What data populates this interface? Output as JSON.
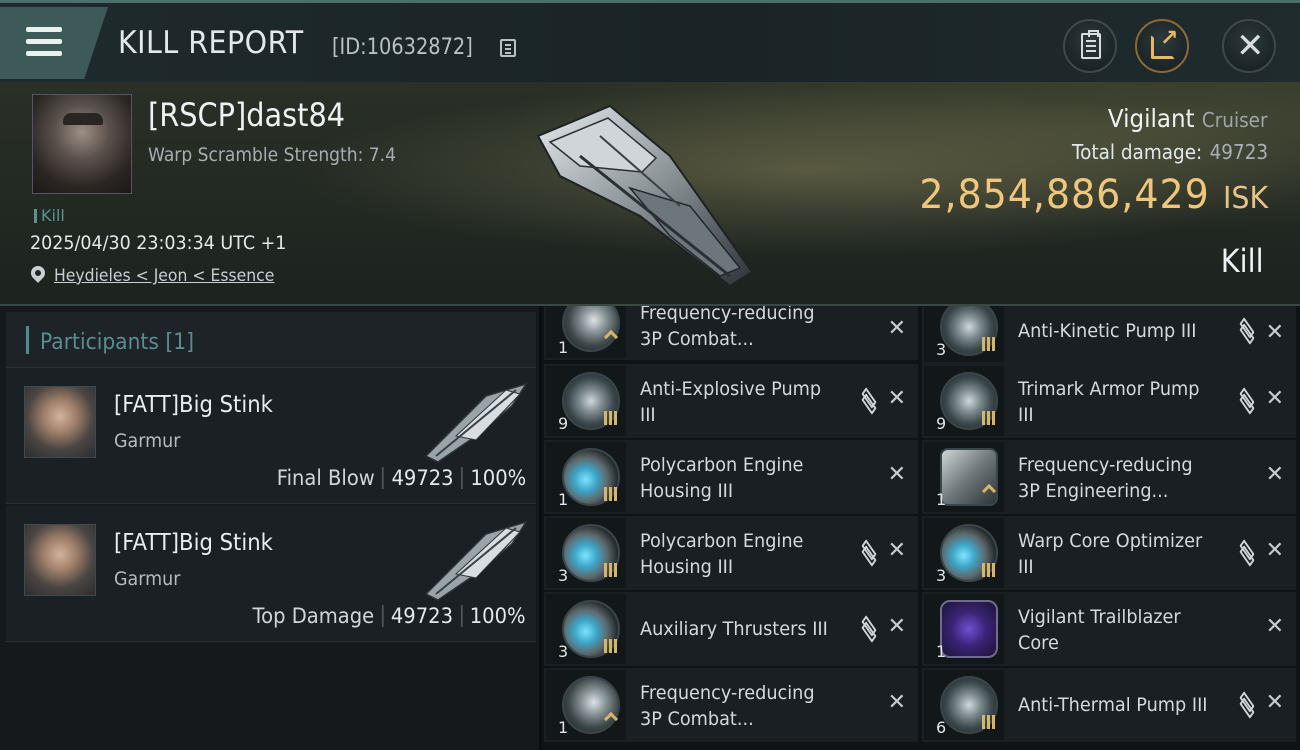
{
  "header": {
    "title": "KILL REPORT",
    "id_text": "[ID:10632872]"
  },
  "victim": {
    "name": "[RSCP]dast84",
    "subtitle": "Warp Scramble Strength: 7.4",
    "kill_tag": "Kill",
    "datetime": "2025/04/30 23:03:34 UTC +1",
    "location": "Heydieles < Jeon < Essence",
    "ship_name": "Vigilant",
    "ship_class": "Cruiser",
    "total_damage_label": "Total damage:",
    "total_damage": "49723",
    "isk_value": "2,854,886,429",
    "isk_unit": "ISK",
    "result": "Kill"
  },
  "participants": {
    "label": "Participants",
    "count": "[1]",
    "rows": [
      {
        "name": "[FATT]Big Stink",
        "ship": "Garmur",
        "role": "Final Blow",
        "damage": "49723",
        "percent": "100%"
      },
      {
        "name": "[FATT]Big Stink",
        "ship": "Garmur",
        "role": "Top Damage",
        "damage": "49723",
        "percent": "100%"
      }
    ]
  },
  "modules": {
    "left": [
      {
        "name": "Frequency-reducing 3P Combat...",
        "qty": "1",
        "icon": "combat-rig-icon"
      },
      {
        "name": "Anti-Explosive Pump III",
        "qty": "9",
        "icon": "armor-pump-icon"
      },
      {
        "name": "Polycarbon Engine Housing III",
        "qty": "1",
        "icon": "engine-rig-icon"
      },
      {
        "name": "Polycarbon Engine Housing III",
        "qty": "3",
        "icon": "engine-rig-icon"
      },
      {
        "name": "Auxiliary Thrusters III",
        "qty": "3",
        "icon": "thruster-rig-icon"
      },
      {
        "name": "Frequency-reducing 3P Combat...",
        "qty": "1",
        "icon": "combat-rig-icon"
      }
    ],
    "right": [
      {
        "name": "Anti-Kinetic Pump III",
        "qty": "3",
        "icon": "armor-pump-icon"
      },
      {
        "name": "Trimark Armor Pump III",
        "qty": "9",
        "icon": "armor-pump-icon"
      },
      {
        "name": "Frequency-reducing 3P Engineering...",
        "qty": "1",
        "icon": "engineering-rig-icon"
      },
      {
        "name": "Warp Core Optimizer III",
        "qty": "3",
        "icon": "warp-rig-icon"
      },
      {
        "name": "Vigilant Trailblazer Core",
        "qty": "1",
        "icon": "core-icon"
      },
      {
        "name": "Anti-Thermal Pump III",
        "qty": "6",
        "icon": "armor-pump-icon"
      }
    ]
  },
  "colors": {
    "accent_teal": "#4f8a8d",
    "isk_gold": "#efc67a",
    "tier_gold": "#d4b56a",
    "core_purple": "#6f4fd3"
  }
}
